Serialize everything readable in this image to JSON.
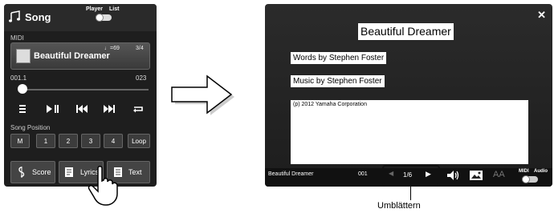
{
  "song_screen": {
    "title": "Song",
    "tab_player": "Player",
    "tab_list": "List",
    "midi_label": "MIDI",
    "song_name": "Beautiful Dreamer",
    "tempo": "♩=69",
    "beat": "3/4",
    "position_start": "001.1",
    "position_end": "023",
    "song_position_label": "Song Position",
    "song_position_buttons": [
      "M",
      "1",
      "2",
      "3",
      "4",
      "Loop"
    ],
    "bottom_buttons": [
      "Score",
      "Lyrics",
      "Text"
    ]
  },
  "lyrics_screen": {
    "title": "Beautiful Dreamer",
    "words_by": "Words by  Stephen Foster",
    "music_by": "Music by   Stephen Foster",
    "copyright": "(p) 2012 Yamaha Corporation",
    "song_name": "Beautiful Dreamer",
    "song_number": "001",
    "page": "1/6",
    "aa": "AA",
    "midi_label": "MIDI",
    "audio_label": "Audio"
  },
  "callout": {
    "label": "Umblättern"
  },
  "icons": [
    "note-icon",
    "score-icon",
    "lyrics-icon",
    "text-icon",
    "hand-pointer-icon",
    "right-arrow-icon",
    "close-icon",
    "volume-icon",
    "image-icon"
  ]
}
